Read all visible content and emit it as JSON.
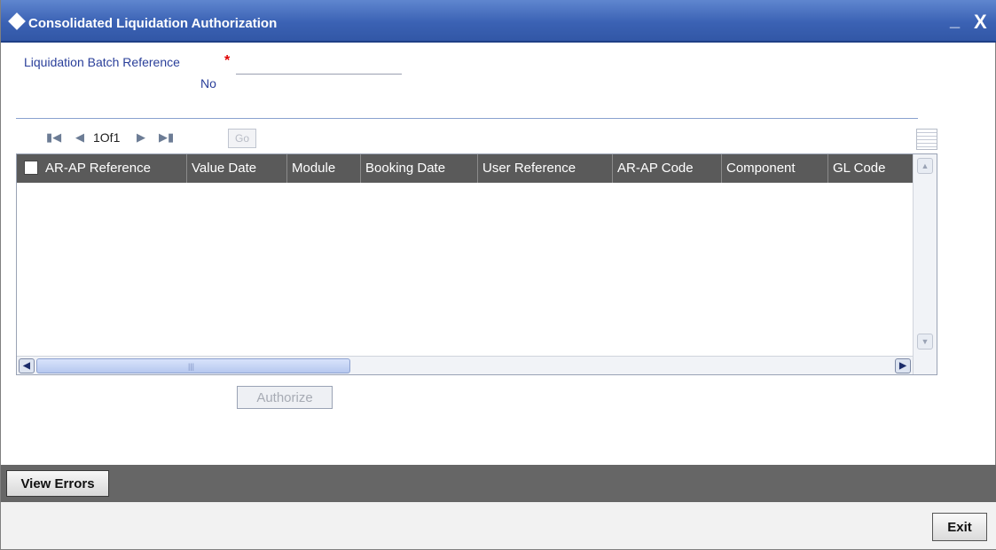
{
  "window": {
    "title": "Consolidated Liquidation Authorization",
    "minimize_glyph": "_",
    "close_glyph": "X"
  },
  "form": {
    "batch_ref_label_line1": "Liquidation Batch Reference",
    "batch_ref_label_line2": "No",
    "required_marker": "*",
    "batch_ref_value": ""
  },
  "pagination": {
    "page_text": "1Of1",
    "go_label": "Go",
    "first_icon": "first-page-icon",
    "prev_icon": "prev-page-icon",
    "next_icon": "next-page-icon",
    "last_icon": "last-page-icon"
  },
  "grid": {
    "columns": [
      "AR-AP Reference",
      "Value Date",
      "Module",
      "Booking Date",
      "User Reference",
      "AR-AP Code",
      "Component",
      "GL Code"
    ],
    "rows": []
  },
  "actions": {
    "authorize_label": "Authorize",
    "view_errors_label": "View Errors",
    "exit_label": "Exit"
  },
  "colors": {
    "titlebar": "#3b62b4",
    "grid_header": "#5a5a5a",
    "footer_bar": "#666666",
    "label_text": "#2a3f9a",
    "required": "#e00000"
  }
}
